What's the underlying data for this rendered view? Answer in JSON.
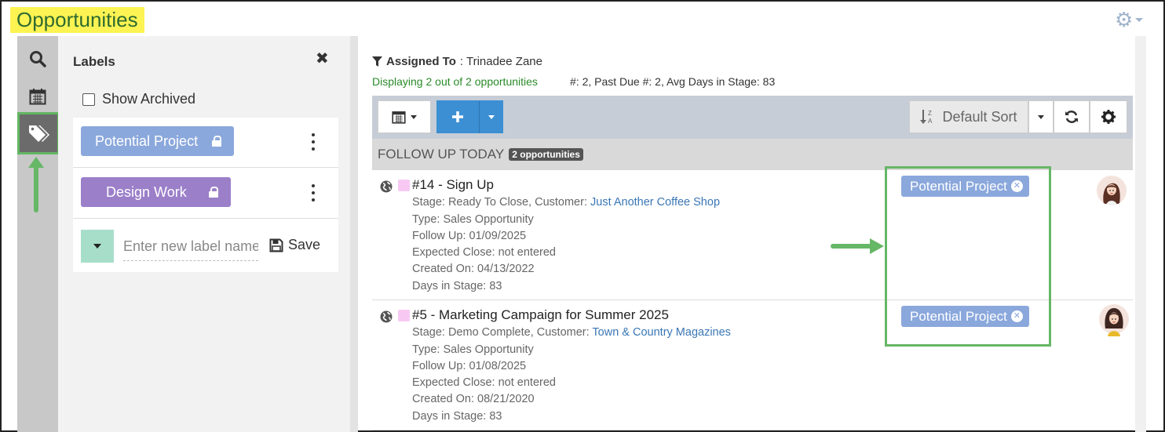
{
  "page": {
    "title": "Opportunities"
  },
  "labels_panel": {
    "title": "Labels",
    "show_archived": "Show Archived",
    "labels": [
      {
        "name": "Potential Project",
        "color": "#8ba8dc"
      },
      {
        "name": "Design Work",
        "color": "#9b7fc9"
      }
    ],
    "new_label_placeholder": "Enter new label name",
    "new_label_color": "#a7dec9",
    "save_label": "Save"
  },
  "main": {
    "assigned_label": "Assigned To",
    "assigned_value": ": Trinadee Zane",
    "displaying": "Displaying 2 out of 2 opportunities",
    "stats": "#: 2, Past Due #: 2, Avg Days in Stage: 83",
    "sort_label": "Default Sort",
    "group": {
      "title": "FOLLOW UP TODAY",
      "badge": "2 opportunities"
    },
    "opportunities": [
      {
        "title": "#14 - Sign Up",
        "stage_prefix": "Stage: Ready To Close, Customer: ",
        "customer": "Just Another Coffee Shop",
        "type": "Type: Sales Opportunity",
        "follow_up": "Follow Up: 01/09/2025",
        "expected_close": "Expected Close: not entered",
        "created_on": "Created On: 04/13/2022",
        "days_in_stage": "Days in Stage: 83",
        "tag": "Potential Project"
      },
      {
        "title": "#5 - Marketing Campaign for Summer 2025",
        "stage_prefix": "Stage: Demo Complete, Customer: ",
        "customer": "Town & Country Magazines",
        "type": "Type: Sales Opportunity",
        "follow_up": "Follow Up: 01/08/2025",
        "expected_close": "Expected Close: not entered",
        "created_on": "Created On: 08/21/2020",
        "days_in_stage": "Days in Stage: 83",
        "tag": "Potential Project"
      }
    ]
  },
  "colors": {
    "highlight": "#fdf352",
    "annotation_green": "#66b766",
    "primary_blue": "#3c8fd3"
  }
}
